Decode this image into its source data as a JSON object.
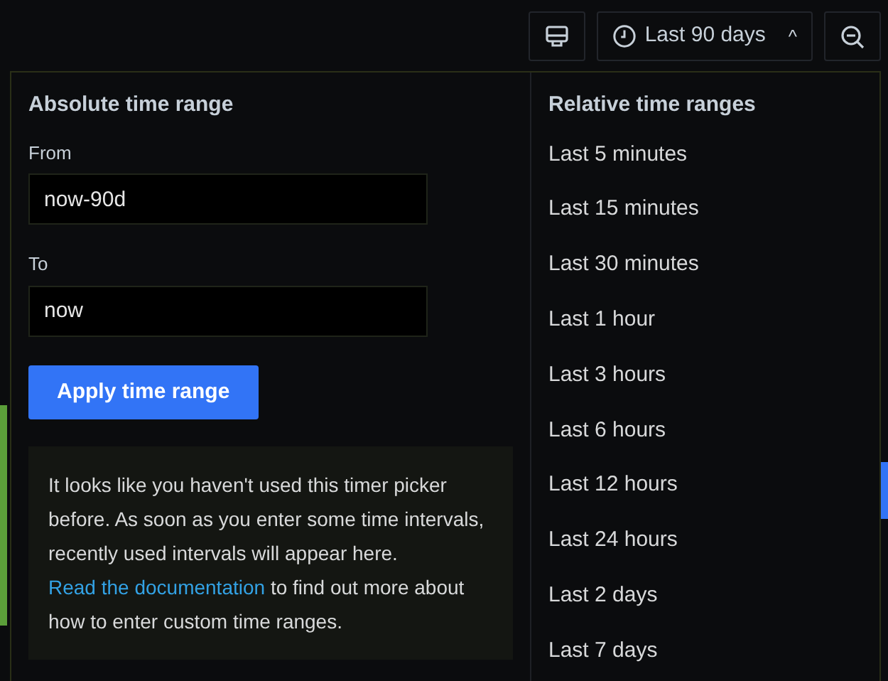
{
  "toolbar": {
    "time_label": "Last 90 days",
    "caret": "^"
  },
  "absolute": {
    "title": "Absolute time range",
    "from_label": "From",
    "from_value": "now-90d",
    "to_label": "To",
    "to_value": "now",
    "apply": "Apply time range"
  },
  "info": {
    "text": "It looks like you haven't used this timer picker before. As soon as you enter some time intervals, recently used intervals will appear here.",
    "link": "Read the documentation",
    "after": " to find out more about how to enter custom time ranges."
  },
  "relative": {
    "title": "Relative time ranges",
    "options": [
      {
        "label": "Last 5 minutes",
        "selected": false
      },
      {
        "label": "Last 15 minutes",
        "selected": false
      },
      {
        "label": "Last 30 minutes",
        "selected": false
      },
      {
        "label": "Last 1 hour",
        "selected": false
      },
      {
        "label": "Last 3 hours",
        "selected": false
      },
      {
        "label": "Last 6 hours",
        "selected": false
      },
      {
        "label": "Last 12 hours",
        "selected": false
      },
      {
        "label": "Last 24 hours",
        "selected": false
      },
      {
        "label": "Last 2 days",
        "selected": false
      },
      {
        "label": "Last 7 days",
        "selected": false
      }
    ]
  }
}
